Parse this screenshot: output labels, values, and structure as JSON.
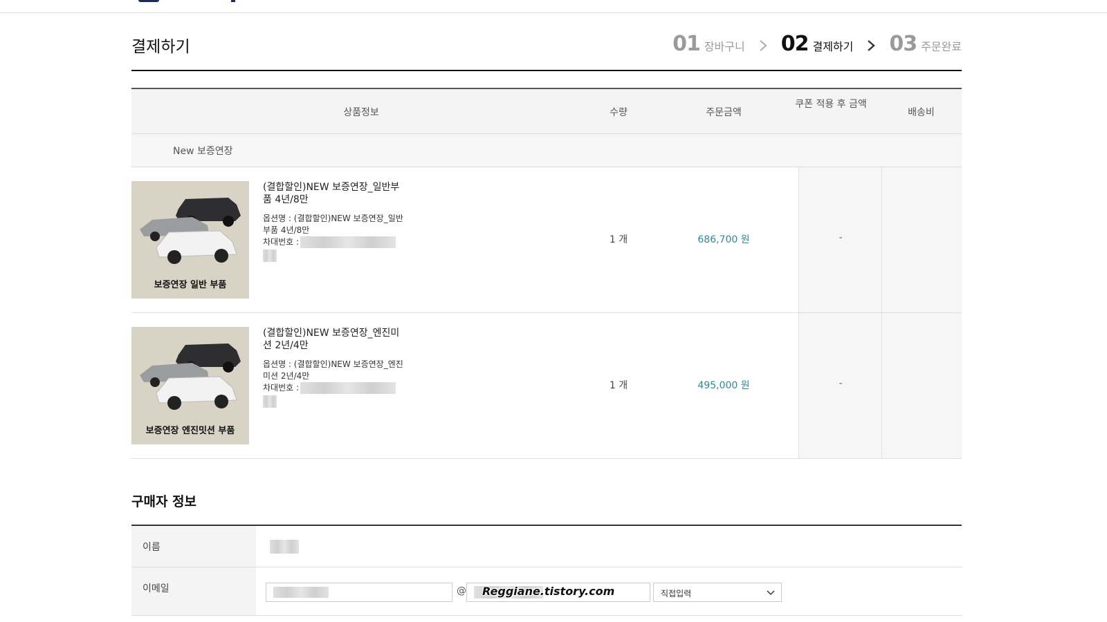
{
  "page": {
    "title": "결제하기"
  },
  "steps": [
    {
      "num": "01",
      "label": "장바구니",
      "active": false
    },
    {
      "num": "02",
      "label": "결제하기",
      "active": true
    },
    {
      "num": "03",
      "label": "주문완료",
      "active": false
    }
  ],
  "cart": {
    "headers": {
      "info": "상품정보",
      "qty": "수량",
      "amount": "주문금액",
      "coupon": "쿠폰 적용 후 금액",
      "shipping": "배송비"
    },
    "group": "New 보증연장",
    "items": [
      {
        "thumb_caption": "보증연장 일반 부품",
        "name": "(결합할인)NEW 보증연장_일반부품 4년/8만",
        "option": "옵션명 : (결합할인)NEW 보증연장_일반부품 4년/8만",
        "car_label": "차대번호 :",
        "qty": "1 개",
        "amount": "686,700 원",
        "coupon": "-"
      },
      {
        "thumb_caption": "보증연장 엔진밋션 부품",
        "name": "(결합할인)NEW 보증연장_엔진미션 2년/4만",
        "option": "옵션명 : (결합할인)NEW 보증연장_엔진미션 2년/4만",
        "car_label": "차대번호 :",
        "qty": "1 개",
        "amount": "495,000 원",
        "coupon": "-"
      }
    ]
  },
  "buyer": {
    "title": "구매자 정보",
    "name_label": "이름",
    "email_label": "이메일",
    "email_at": "@",
    "email_domain_select": "직접입력",
    "watermark": "Reggiane.tistory.com"
  },
  "colors": {
    "price": "#2a8a9a",
    "header_bg": "#f4f4f4"
  }
}
